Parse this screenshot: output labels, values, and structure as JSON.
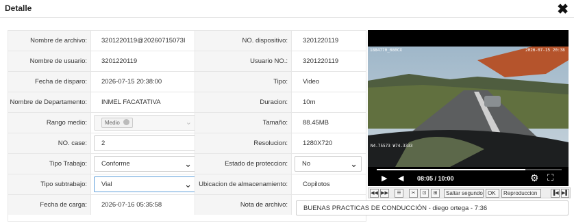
{
  "header": {
    "title": "Detalle",
    "close_icon": "close-icon"
  },
  "rows": [
    {
      "label1": "Nombre de archivo:",
      "value1": "3201220119@20260715073I",
      "label2": "NO. dispositivo:",
      "value2": "3201220119"
    },
    {
      "label1": "Nombre de usuario:",
      "value1": "3201220119",
      "label2": "Usuario NO.:",
      "value2": "3201220119"
    },
    {
      "label1": "Fecha de disparo:",
      "value1": "2026-07-15 20:38:00",
      "label2": "Tipo:",
      "value2": "Video"
    },
    {
      "label1": "Nombre de Departamento:",
      "value1": "INMEL FACATATIVA",
      "label2": "Duracion:",
      "value2": "10m"
    },
    {
      "label1": "Rango medio:",
      "value1": "",
      "label2": "Tamaño:",
      "value2": "88.45MB"
    },
    {
      "label1": "NO. case:",
      "value1": "",
      "label2": "Resolucion:",
      "value2": "1280X720"
    },
    {
      "label1": "Tipo Trabajo:",
      "value1": "",
      "label2": "Estado de proteccion:",
      "value2": ""
    },
    {
      "label1": "Tipo subtrabajo:",
      "value1": "",
      "label2": "Ubicacion de almacenamiento:",
      "value2": "Copilotos"
    },
    {
      "label1": "Fecha de carga:",
      "value1": "2026-07-16 05:35:58",
      "label2": "Nota de archivo:",
      "value2": ""
    }
  ],
  "fields": {
    "rango_medio_tag": "Medio",
    "no_case": "2",
    "tipo_trabajo": "Conforme",
    "estado_proteccion": "No",
    "tipo_subtrabajo": "Vial",
    "nota_archivo": "BUENAS PRACTICAS DE CONDUCCIÓN - diego ortega - 7:36"
  },
  "video": {
    "overlay_top_left": "1884770_080CX",
    "overlay_top_right": "2026-07-15 20:38",
    "overlay_bottom_left": "N4.75573 W74.3333",
    "time": "08:05 / 10:00",
    "progress": 0.805
  },
  "toolbar": {
    "buttons": [
      "◀◀",
      "▶▶",
      "☰",
      "✂",
      "⊡",
      "⊞"
    ],
    "skip_label": "Saltar segundo",
    "ok_label": "OK",
    "playback_label": "Reproduccion",
    "end_buttons": [
      "▐◀",
      "▶▌"
    ]
  }
}
